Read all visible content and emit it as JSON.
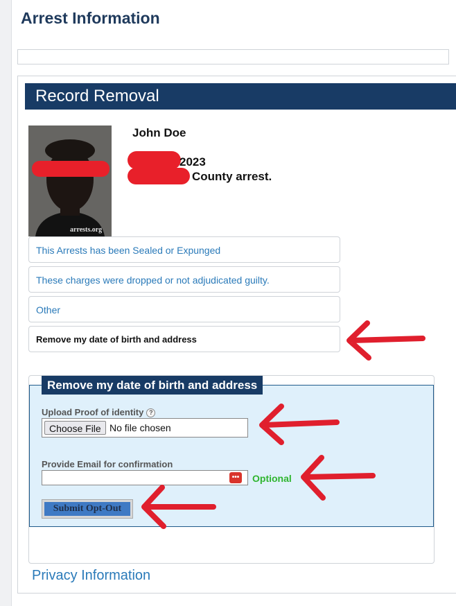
{
  "page": {
    "title": "Arrest Information"
  },
  "panel": {
    "header": "Record Removal"
  },
  "person": {
    "name": "John Doe",
    "arrest_date_suffix": "2023",
    "arrest_county_suffix": "County arrest.",
    "watermark": "arrests.org"
  },
  "options": [
    {
      "label": "This Arrests has been Sealed or Expunged",
      "selected": false
    },
    {
      "label": "These charges were dropped or not adjudicated guilty.",
      "selected": false
    },
    {
      "label": "Other",
      "selected": false
    },
    {
      "label": "Remove my date of birth and address",
      "selected": true
    }
  ],
  "form": {
    "legend": "Remove my date of birth and address",
    "upload_label": "Upload Proof of identity",
    "help_icon_glyph": "?",
    "choose_file_label": "Choose File",
    "file_status": "No file chosen",
    "email_label": "Provide Email for confirmation",
    "email_value": "",
    "password_manager_icon": "•••",
    "optional_text": "Optional",
    "submit_label": "Submit Opt-Out"
  },
  "footer": {
    "privacy_link": "Privacy Information"
  },
  "colors": {
    "header_bg": "#183b65",
    "link": "#2a7ab9",
    "optional": "#2fb52f",
    "redaction": "#e8202a",
    "annotation_arrow": "#e01f2d",
    "form_bg": "#dff0fb"
  },
  "icons": [
    "help-icon",
    "password-manager-icon",
    "annotation-arrow"
  ]
}
